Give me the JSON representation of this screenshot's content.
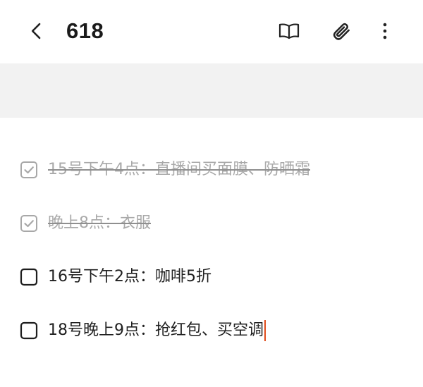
{
  "header": {
    "title": "618",
    "icons": {
      "back": "chevron-left-icon",
      "reader": "book-icon",
      "attach": "paperclip-icon",
      "more": "more-vertical-icon"
    }
  },
  "checklist": [
    {
      "text": "15号下午4点：直播间买面膜、防晒霜",
      "checked": true
    },
    {
      "text": "晚上8点：衣服",
      "checked": true
    },
    {
      "text": "16号下午2点：咖啡5折",
      "checked": false
    },
    {
      "text": "18号晚上9点：抢红包、买空调",
      "checked": false
    }
  ],
  "colors": {
    "caret": "#e04b1a",
    "done_text": "#a9a9a9",
    "band": "#f2f2f2"
  }
}
